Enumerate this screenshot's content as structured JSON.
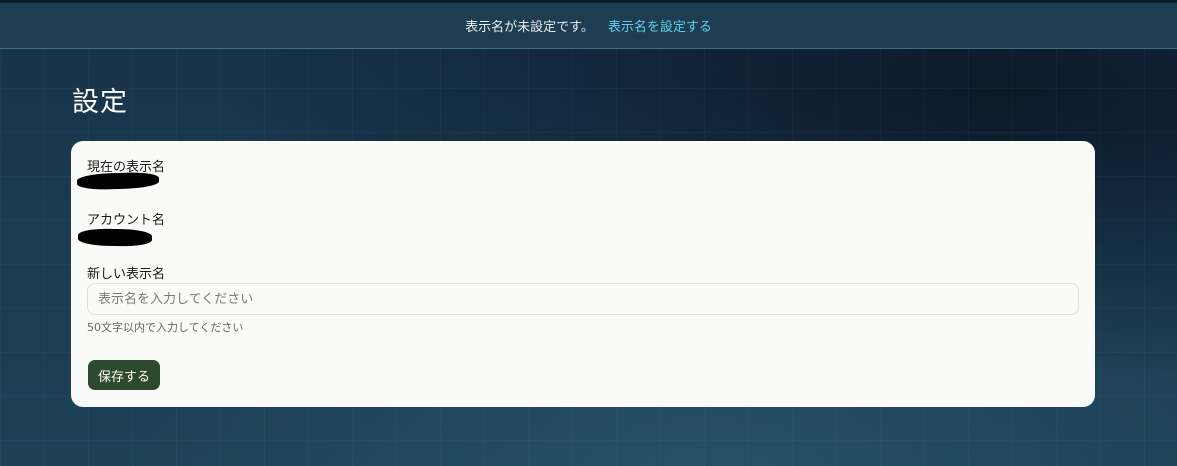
{
  "notice": {
    "message": "表示名が未設定です。",
    "link_label": "表示名を設定する"
  },
  "page": {
    "title": "設定"
  },
  "settings": {
    "current_display_name_label": "現在の表示名",
    "account_name_label": "アカウント名",
    "new_display_name_label": "新しい表示名",
    "input_placeholder": "表示名を入力してください",
    "input_value": "",
    "helper_text": "50文字以内で入力してください",
    "save_label": "保存する"
  },
  "colors": {
    "notice_link": "#5fd0ea",
    "save_button": "#2d4a2e",
    "card_background": "#fafaf8"
  }
}
